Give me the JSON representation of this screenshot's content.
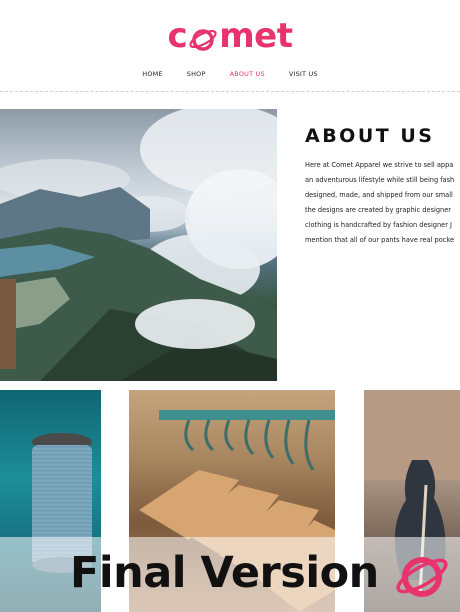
{
  "header": {
    "logo_text_before": "c",
    "logo_text_after": "met",
    "logo_icon": "planet-icon",
    "brand_color": "#e8336d"
  },
  "nav": {
    "items": [
      {
        "label": "HOME",
        "active": false
      },
      {
        "label": "SHOP",
        "active": false
      },
      {
        "label": "ABOUT US",
        "active": true
      },
      {
        "label": "VISIT US",
        "active": false
      }
    ]
  },
  "about": {
    "title": "ABOUT US",
    "lines": [
      "Here at Comet Apparel we strive to sell appa",
      "an adventurous lifestyle while still being fash",
      "designed, made, and shipped from our small",
      "the designs are created by graphic designer",
      "clothing is handcrafted by fashion designer J",
      "mention that all of our pants have real pocke"
    ]
  },
  "banner": {
    "text": "Final Version",
    "icon": "planet-icon"
  }
}
